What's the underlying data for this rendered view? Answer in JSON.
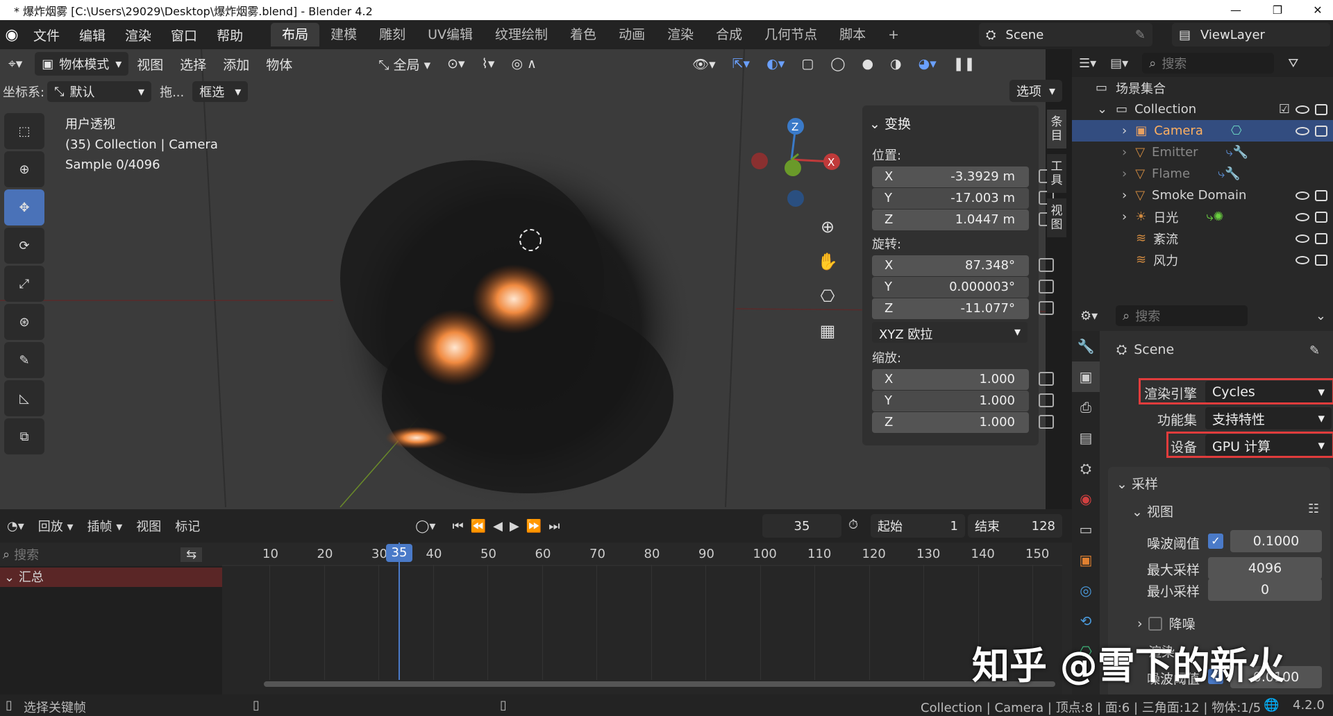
{
  "window": {
    "title": "* 爆炸烟雾 [C:\\Users\\29029\\Desktop\\爆炸烟雾.blend] - Blender 4.2",
    "minimize": "—",
    "maximize": "❐",
    "close": "✕"
  },
  "menu": [
    "文件",
    "编辑",
    "渲染",
    "窗口",
    "帮助"
  ],
  "workspaces": [
    "布局",
    "建模",
    "雕刻",
    "UV编辑",
    "纹理绘制",
    "着色",
    "动画",
    "渲染",
    "合成",
    "几何节点",
    "脚本"
  ],
  "scene": {
    "name": "Scene",
    "viewlayer": "ViewLayer"
  },
  "viewport_header": {
    "mode": "物体模式",
    "menus": [
      "视图",
      "选择",
      "添加",
      "物体"
    ],
    "transform": "全局"
  },
  "viewport_sub": {
    "coord_label": "坐标系:",
    "coord_value": "默认",
    "drag": "拖...",
    "select": "框选",
    "options": "选项"
  },
  "overlay_text": {
    "view": "用户透视",
    "collection": "(35) Collection | Camera",
    "sample": "Sample 0/4096"
  },
  "gizmo": {
    "z": "Z",
    "x": "X"
  },
  "npanel": {
    "header": "变换",
    "location": "位置:",
    "loc": {
      "x": "-3.3929 m",
      "y": "-17.003 m",
      "z": "1.0447 m"
    },
    "rotation": "旋转:",
    "rot": {
      "x": "87.348°",
      "y": "0.000003°",
      "z": "-11.077°"
    },
    "rot_mode": "XYZ 欧拉",
    "scale": "缩放:",
    "scl": {
      "x": "1.000",
      "y": "1.000",
      "z": "1.000"
    },
    "axis_x": "X",
    "axis_y": "Y",
    "axis_z": "Z"
  },
  "side_tabs": [
    "条目",
    "工具",
    "视图"
  ],
  "outliner": {
    "search": "搜索",
    "root": "场景集合",
    "collection": "Collection",
    "items": [
      "Camera",
      "Emitter",
      "Flame",
      "Smoke Domain",
      "日光",
      "紊流",
      "风力"
    ]
  },
  "properties": {
    "search": "搜索",
    "scene": "Scene",
    "engine_label": "渲染引擎",
    "engine": "Cycles",
    "featureset_label": "功能集",
    "featureset": "支持特性",
    "device_label": "设备",
    "device": "GPU 计算",
    "sampling": "采样",
    "viewport": "视图",
    "noise_threshold_label": "噪波阈值",
    "noise_threshold": "0.1000",
    "max_samples_label": "最大采样",
    "max_samples": "4096",
    "min_samples_label": "最小采样",
    "min_samples": "0",
    "denoise": "降噪",
    "render": "渲染",
    "noise_threshold2": "0.0100",
    "highlight_color": "#e03c3c"
  },
  "timeline": {
    "menus": [
      "回放",
      "插帧",
      "视图",
      "标记"
    ],
    "current": "35",
    "start_label": "起始",
    "start": "1",
    "end_label": "结束",
    "end": "128",
    "search": "搜索",
    "summary": "汇总",
    "ticks": [
      "10",
      "20",
      "30",
      "40",
      "50",
      "60",
      "70",
      "80",
      "90",
      "100",
      "110",
      "120",
      "130",
      "140",
      "150"
    ],
    "cur_marker": "35"
  },
  "statusbar": {
    "left": "选择关键帧",
    "right": "Collection | Camera | 顶点:8 | 面:6 | 三角面:12 | 物体:1/5",
    "version": "4.2.0"
  },
  "watermark": "知乎 @雪下的新火"
}
